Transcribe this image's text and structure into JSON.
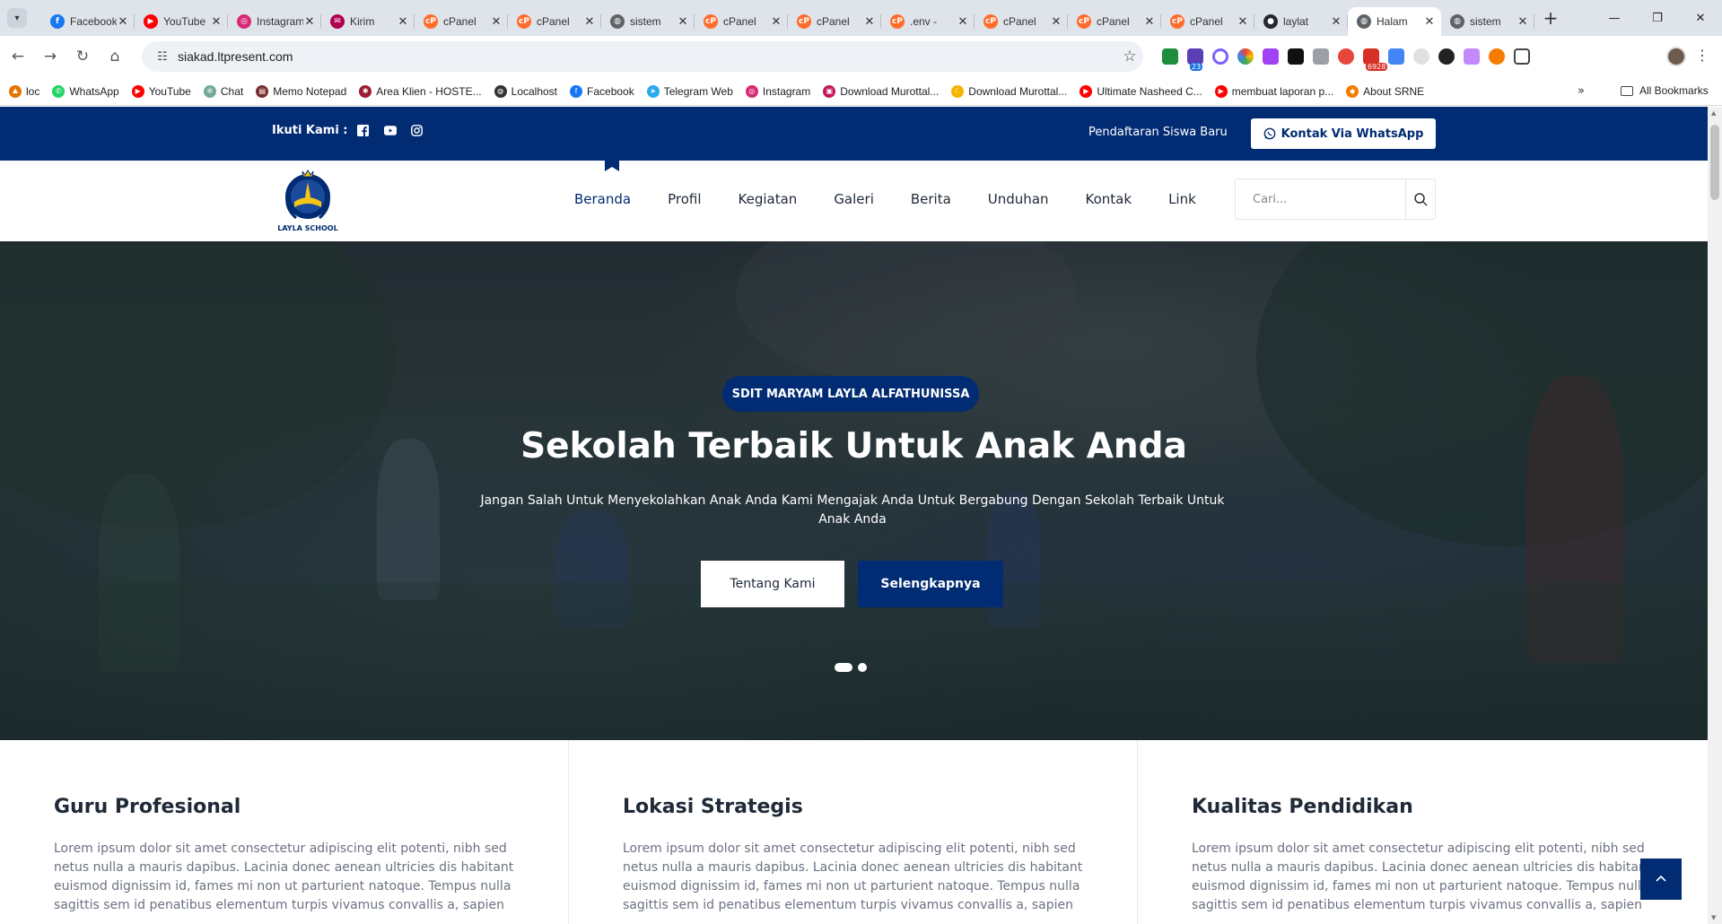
{
  "browser": {
    "tabs": [
      {
        "label": "Facebook",
        "icon": "facebook-icon",
        "color": "#1877f2",
        "glyph": "f"
      },
      {
        "label": "YouTube",
        "icon": "youtube-icon",
        "color": "#ff0000",
        "glyph": "▶"
      },
      {
        "label": "Instagram",
        "icon": "instagram-icon",
        "color": "#d62976",
        "glyph": "◎"
      },
      {
        "label": "Kirim",
        "icon": "app-icon",
        "color": "#b0004d",
        "glyph": "✉"
      },
      {
        "label": "cPanel",
        "icon": "cpanel-icon",
        "color": "#ff6c2c",
        "glyph": "cP"
      },
      {
        "label": "cPanel",
        "icon": "cpanel-icon",
        "color": "#ff6c2c",
        "glyph": "cP"
      },
      {
        "label": "sistem",
        "icon": "globe-icon",
        "color": "#5f6368",
        "glyph": "◍"
      },
      {
        "label": "cPanel",
        "icon": "cpanel-icon",
        "color": "#ff6c2c",
        "glyph": "cP"
      },
      {
        "label": "cPanel",
        "icon": "cpanel-icon",
        "color": "#ff6c2c",
        "glyph": "cP"
      },
      {
        "label": ".env -",
        "icon": "cpanel-icon",
        "color": "#ff6c2c",
        "glyph": "cP"
      },
      {
        "label": "cPanel",
        "icon": "cpanel-icon",
        "color": "#ff6c2c",
        "glyph": "cP"
      },
      {
        "label": "cPanel",
        "icon": "cpanel-icon",
        "color": "#ff6c2c",
        "glyph": "cP"
      },
      {
        "label": "cPanel",
        "icon": "cpanel-icon",
        "color": "#ff6c2c",
        "glyph": "cP"
      },
      {
        "label": "laylat",
        "icon": "github-icon",
        "color": "#24292f",
        "glyph": "●"
      },
      {
        "label": "Halam",
        "icon": "globe-icon",
        "color": "#5f6368",
        "glyph": "◍",
        "active": true
      },
      {
        "label": "sistem",
        "icon": "globe-icon",
        "color": "#5f6368",
        "glyph": "◍"
      }
    ],
    "url": "siakad.ltpresent.com",
    "badges": {
      "ext1": "23",
      "ext2": "6928"
    },
    "bookmarks": [
      {
        "label": "loc",
        "icon": "bookmark-icon",
        "color": "#e37400",
        "glyph": "⛰"
      },
      {
        "label": "WhatsApp",
        "icon": "whatsapp-icon",
        "color": "#25d366",
        "glyph": "✆"
      },
      {
        "label": "YouTube",
        "icon": "youtube-icon",
        "color": "#ff0000",
        "glyph": "▶"
      },
      {
        "label": "Chat",
        "icon": "chatgpt-icon",
        "color": "#74aa9c",
        "glyph": "✲"
      },
      {
        "label": "Memo Notepad",
        "icon": "memo-icon",
        "color": "#7b2d2d",
        "glyph": "▤"
      },
      {
        "label": "Area Klien - HOSTE...",
        "icon": "hosting-icon",
        "color": "#9b1c31",
        "glyph": "✱"
      },
      {
        "label": "Localhost",
        "icon": "globe-icon",
        "color": "#333333",
        "glyph": "◍"
      },
      {
        "label": "Facebook",
        "icon": "facebook-icon",
        "color": "#1877f2",
        "glyph": "f"
      },
      {
        "label": "Telegram Web",
        "icon": "telegram-icon",
        "color": "#2aabee",
        "glyph": "➤"
      },
      {
        "label": "Instagram",
        "icon": "instagram-icon",
        "color": "#d62976",
        "glyph": "◎"
      },
      {
        "label": "Download Murottal...",
        "icon": "download-icon",
        "color": "#c2185b",
        "glyph": "▣"
      },
      {
        "label": "Download Murottal...",
        "icon": "moon-icon",
        "color": "#f4b400",
        "glyph": "☾"
      },
      {
        "label": "Ultimate Nasheed C...",
        "icon": "youtube-icon",
        "color": "#ff0000",
        "glyph": "▶"
      },
      {
        "label": "membuat laporan p...",
        "icon": "youtube-icon",
        "color": "#ff0000",
        "glyph": "▶"
      },
      {
        "label": "About SRNE",
        "icon": "srne-icon",
        "color": "#f57c00",
        "glyph": "◆"
      }
    ],
    "all_bookmarks": "All Bookmarks"
  },
  "topbar": {
    "follow_label": "Ikuti Kami :",
    "registration": "Pendaftaran Siswa Baru",
    "whatsapp_button": "Kontak Via WhatsApp"
  },
  "nav": {
    "logo_text": "LAYLA SCHOOL",
    "items": [
      "Beranda",
      "Profil",
      "Kegiatan",
      "Galeri",
      "Berita",
      "Unduhan",
      "Kontak",
      "Link"
    ],
    "search_placeholder": "Cari..."
  },
  "hero": {
    "badge": "SDIT MARYAM LAYLA ALFATHUNISSA",
    "title": "Sekolah Terbaik Untuk Anak Anda",
    "subtitle": "Jangan Salah Untuk Menyekolahkan Anak Anda Kami Mengajak Anda Untuk Bergabung Dengan Sekolah Terbaik Untuk Anak Anda",
    "button_about": "Tentang Kami",
    "button_more": "Selengkapnya"
  },
  "features": [
    {
      "title": "Guru Profesional",
      "text": "Lorem ipsum dolor sit amet consectetur adipiscing elit potenti, nibh sed netus nulla a mauris dapibus. Lacinia donec aenean ultricies dis habitant euismod dignissim id, fames mi non ut parturient natoque. Tempus nulla sagittis sem id penatibus elementum turpis vivamus convallis a, sapien"
    },
    {
      "title": "Lokasi Strategis",
      "text": "Lorem ipsum dolor sit amet consectetur adipiscing elit potenti, nibh sed netus nulla a mauris dapibus. Lacinia donec aenean ultricies dis habitant euismod dignissim id, fames mi non ut parturient natoque. Tempus nulla sagittis sem id penatibus elementum turpis vivamus convallis a, sapien"
    },
    {
      "title": "Kualitas Pendidikan",
      "text": "Lorem ipsum dolor sit amet consectetur adipiscing elit potenti, nibh sed netus nulla a mauris dapibus. Lacinia donec aenean ultricies dis habitant euismod dignissim id, fames mi non ut parturient natoque. Tempus nulla sagittis sem id penatibus elementum turpis vivamus convallis a, sapien"
    }
  ],
  "colors": {
    "brand": "#012b72",
    "text": "#1f2937",
    "muted": "#6b7280"
  }
}
